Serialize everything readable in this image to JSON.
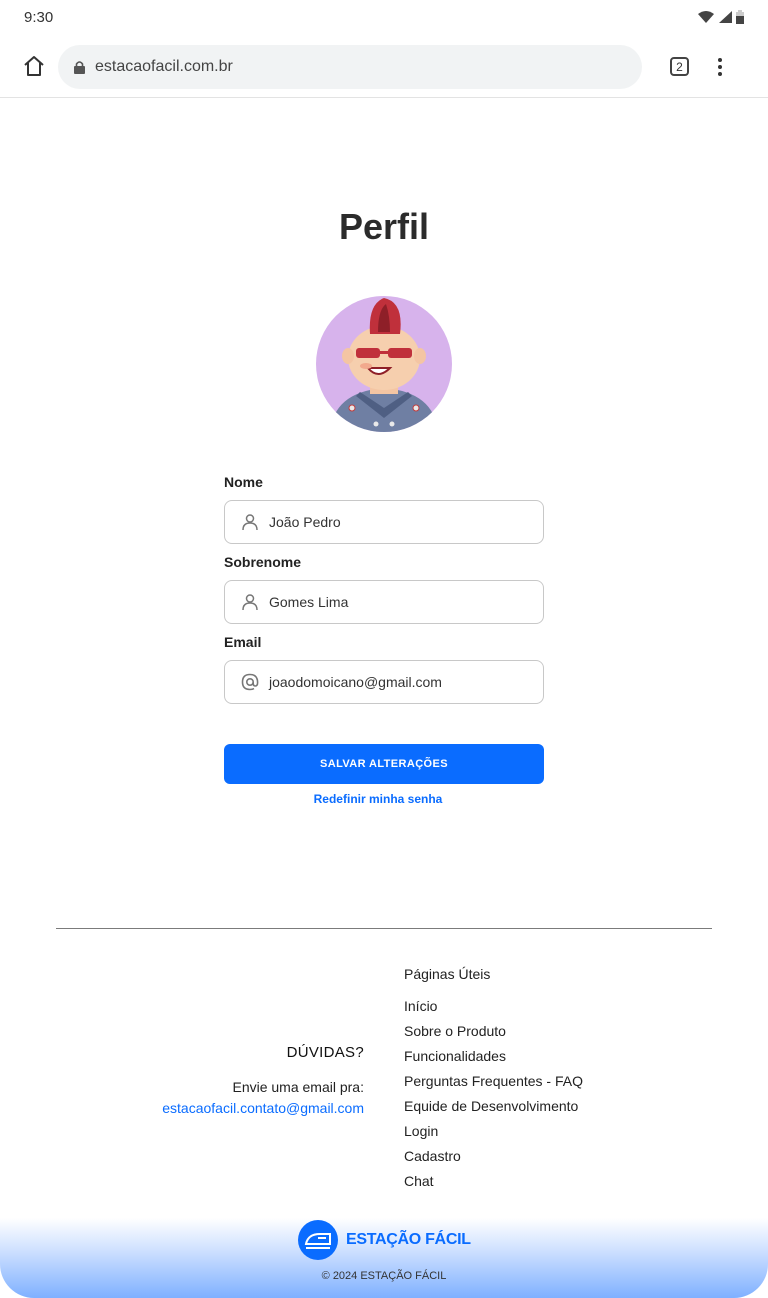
{
  "status_bar": {
    "time": "9:30"
  },
  "browser": {
    "url": "estacaofacil.com.br",
    "tab_count": "2"
  },
  "profile": {
    "title": "Perfil",
    "fields": [
      {
        "label": "Nome",
        "value": "João Pedro",
        "icon": "user-icon"
      },
      {
        "label": "Sobrenome",
        "value": "Gomes Lima",
        "icon": "user-icon"
      },
      {
        "label": "Email",
        "value": "joaodomoicano@gmail.com",
        "icon": "at-icon"
      }
    ],
    "save_label": "SALVAR ALTERAÇÕES",
    "reset_label": "Redefinir minha senha"
  },
  "footer": {
    "doubts_title": "DÚVIDAS?",
    "doubts_text": "Envie uma email pra:",
    "doubts_email": "estacaofacil.contato@gmail.com",
    "useful_title": "Páginas Úteis",
    "links": [
      "Início",
      "Sobre o Produto",
      "Funcionalidades",
      "Perguntas Frequentes - FAQ",
      "Equide de Desenvolvimento",
      "Login",
      "Cadastro",
      "Chat"
    ],
    "brand": "ESTAÇÃO FÁCIL",
    "copyright": "© 2024 ESTAÇÃO FÁCIL"
  },
  "colors": {
    "accent": "#0a6cff",
    "avatar_bg": "#d7b3ec"
  }
}
